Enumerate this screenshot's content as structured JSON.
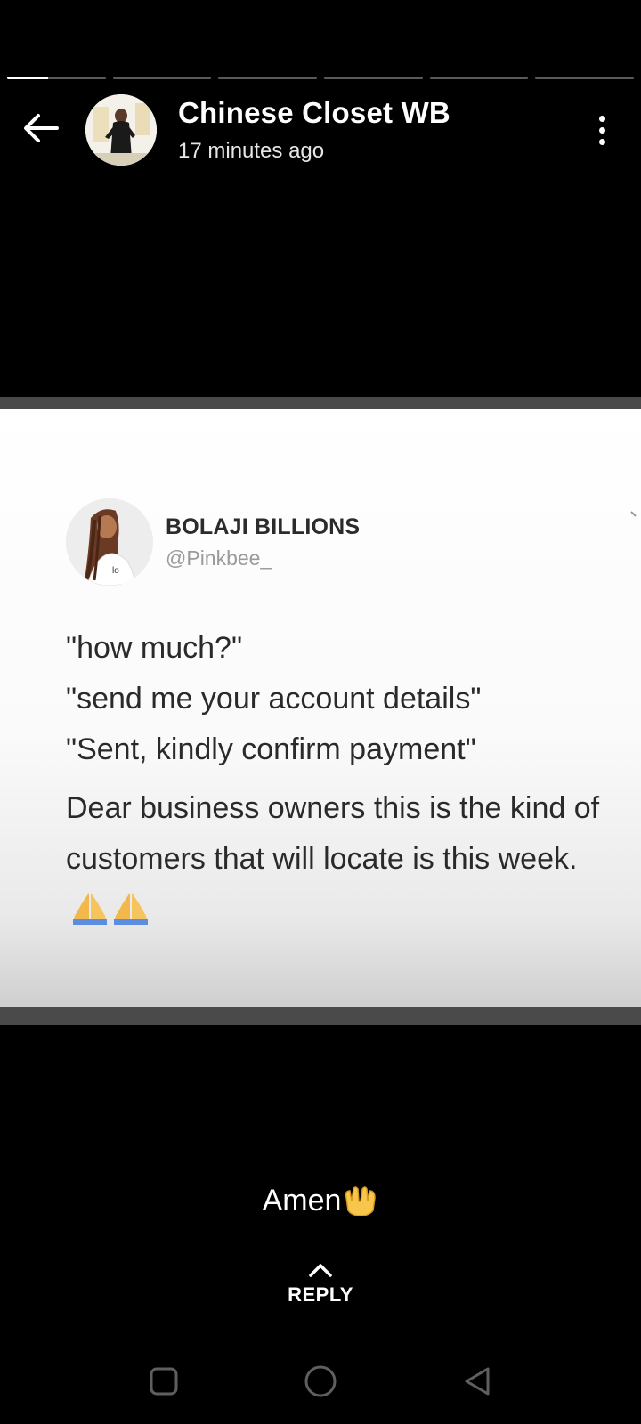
{
  "progress": {
    "segments": [
      0.42,
      0,
      0,
      0,
      0,
      0
    ]
  },
  "header": {
    "title": "Chinese Closet WB",
    "time": "17 minutes ago"
  },
  "tweet": {
    "name": "BOLAJI BILLIONS",
    "handle": "@Pinkbee_",
    "lines": [
      "\"how much?\"",
      "\"send me your account details\"",
      "\"Sent, kindly confirm payment\""
    ],
    "body": "Dear business owners this is the kind of customers that will locate is this week."
  },
  "caption": {
    "text": "Amen"
  },
  "reply": {
    "label": "REPLY"
  },
  "colors": {
    "background": "#000000",
    "text": "#ffffff",
    "progress_track": "#5a5a5a",
    "progress_fill": "#ffffff"
  },
  "icons": {
    "back": "arrow-left-icon",
    "menu": "more-vertical-icon",
    "reply": "chevron-up-icon",
    "nav_recents": "square-icon",
    "nav_home": "circle-icon",
    "nav_back": "triangle-left-icon"
  }
}
